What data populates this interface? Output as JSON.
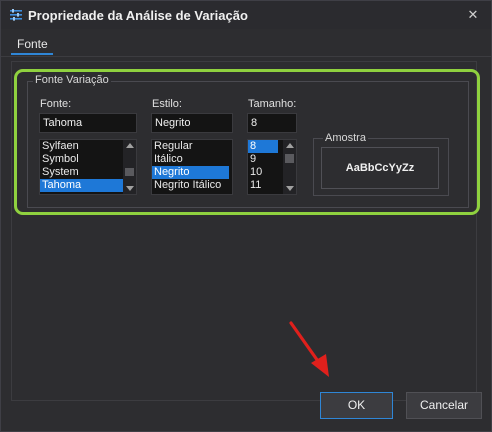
{
  "window": {
    "title": "Propriedade da Análise de Variação"
  },
  "tabs": [
    {
      "label": "Fonte"
    }
  ],
  "font_group": {
    "legend": "Fonte Variação",
    "font": {
      "label": "Fonte:",
      "value": "Tahoma",
      "options": [
        "Sylfaen",
        "Symbol",
        "System",
        "Tahoma"
      ],
      "selected": "Tahoma"
    },
    "style": {
      "label": "Estilo:",
      "value": "Negrito",
      "options": [
        "Regular",
        "Itálico",
        "Negrito",
        "Negrito Itálico"
      ],
      "selected": "Negrito"
    },
    "size": {
      "label": "Tamanho:",
      "value": "8",
      "options": [
        "8",
        "9",
        "10",
        "11"
      ],
      "selected": "8"
    },
    "sample": {
      "legend": "Amostra",
      "text": "AaBbCcYyZz"
    }
  },
  "buttons": {
    "ok": "OK",
    "cancel": "Cancelar"
  },
  "colors": {
    "highlight": "#8fd13f",
    "accent": "#1e78d7",
    "arrow": "#e0201c"
  }
}
